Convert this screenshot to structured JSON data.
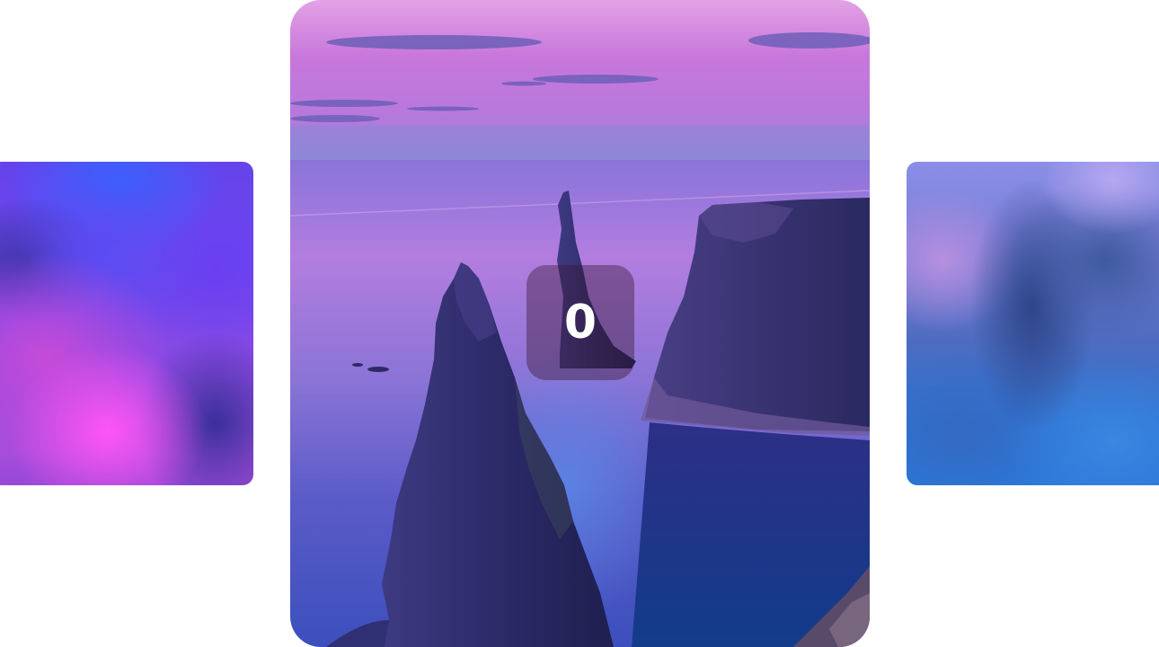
{
  "carousel": {
    "active_index_label": "0",
    "slides": [
      {
        "id": "prev",
        "state": "blurred"
      },
      {
        "id": "current",
        "state": "active",
        "scene": "sea-stacks-at-dusk"
      },
      {
        "id": "next",
        "state": "blurred"
      }
    ]
  },
  "colors": {
    "background": "#ffffff",
    "sky_top": "#d9a0e6",
    "sky_mid": "#c26fd8",
    "sea": "#6a6cd8",
    "deep_water": "#10307a",
    "rock": "#2b2a66",
    "badge": "#3c1932"
  }
}
